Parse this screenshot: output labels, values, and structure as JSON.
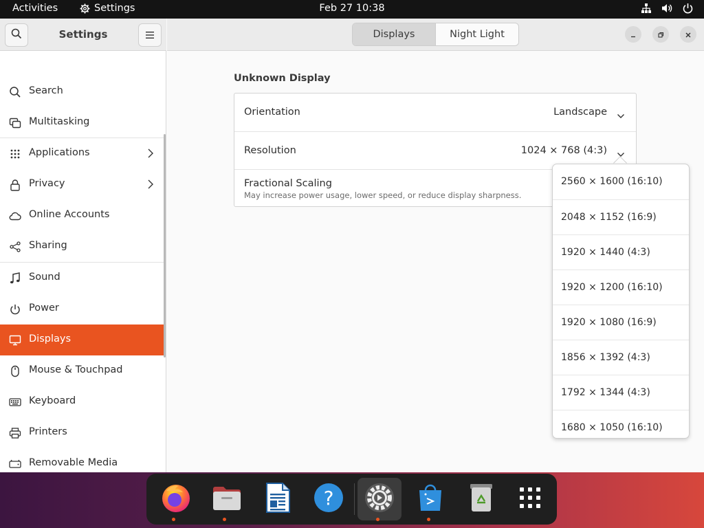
{
  "topbar": {
    "activities": "Activities",
    "app_name": "Settings",
    "clock": "Feb 27  10:38",
    "tray_icons": [
      "network-icon",
      "volume-icon",
      "power-icon"
    ]
  },
  "sidebar": {
    "title": "Settings",
    "items": [
      {
        "label": "Search",
        "icon": "search-icon"
      },
      {
        "label": "Multitasking",
        "icon": "multitasking-icon"
      },
      {
        "label": "Applications",
        "icon": "apps-grid-icon",
        "has_chevron": true
      },
      {
        "label": "Privacy",
        "icon": "lock-icon",
        "has_chevron": true
      },
      {
        "label": "Online Accounts",
        "icon": "cloud-icon"
      },
      {
        "label": "Sharing",
        "icon": "share-icon"
      },
      {
        "label": "Sound",
        "icon": "music-note-icon"
      },
      {
        "label": "Power",
        "icon": "power-icon"
      },
      {
        "label": "Displays",
        "icon": "display-icon",
        "active": true
      },
      {
        "label": "Mouse & Touchpad",
        "icon": "mouse-icon"
      },
      {
        "label": "Keyboard",
        "icon": "keyboard-icon"
      },
      {
        "label": "Printers",
        "icon": "printer-icon"
      },
      {
        "label": "Removable Media",
        "icon": "media-icon"
      }
    ]
  },
  "header": {
    "tabs": [
      {
        "label": "Displays",
        "selected": true
      },
      {
        "label": "Night Light",
        "selected": false
      }
    ]
  },
  "display": {
    "name": "Unknown Display",
    "orientation": {
      "label": "Orientation",
      "value": "Landscape"
    },
    "resolution": {
      "label": "Resolution",
      "value": "1024 × 768 (4:3)"
    },
    "scaling": {
      "label": "Fractional Scaling",
      "description": "May increase power usage, lower speed, or reduce display sharpness."
    }
  },
  "resolution_options": [
    "2560 × 1600 (16:10)",
    "2048 × 1152 (16:9)",
    "1920 × 1440 (4:3)",
    "1920 × 1200 (16:10)",
    "1920 × 1080 (16:9)",
    "1856 × 1392 (4:3)",
    "1792 × 1344 (4:3)",
    "1680 × 1050 (16:10)"
  ],
  "dock": {
    "apps": [
      "firefox-icon",
      "files-icon",
      "writer-icon",
      "help-icon",
      "settings-icon",
      "app-center-icon",
      "trash-icon",
      "show-apps-icon"
    ]
  },
  "colors": {
    "accent": "#e95420",
    "topbar": "#141414",
    "dock": "#1f1f1f"
  }
}
